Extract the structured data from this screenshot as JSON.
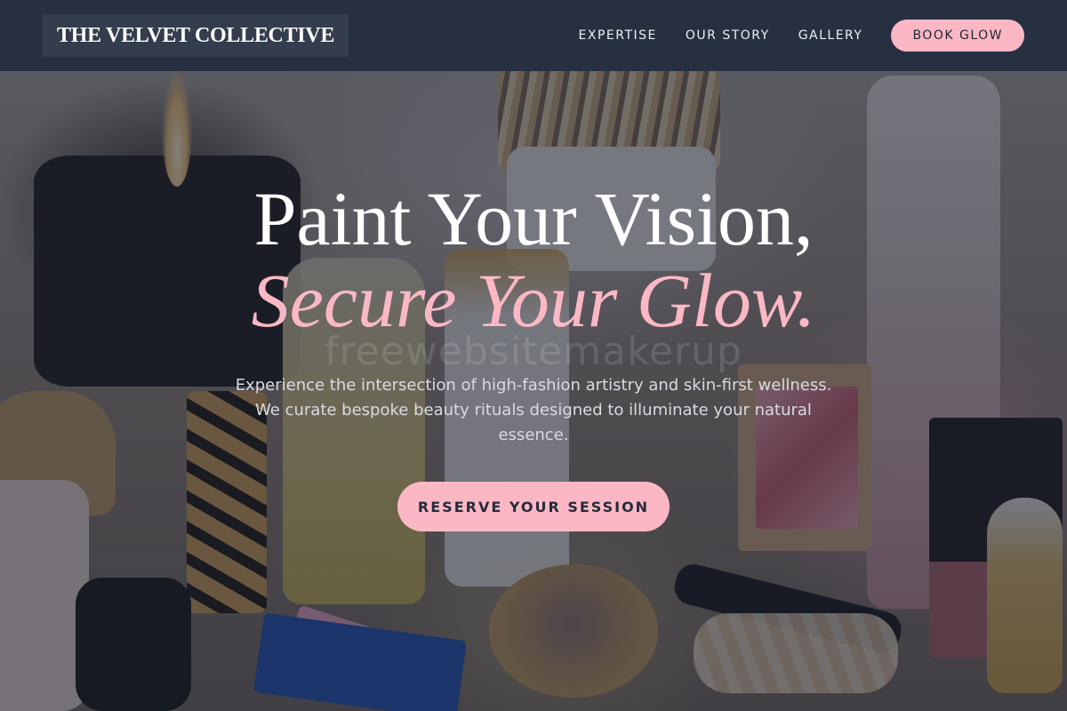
{
  "header": {
    "logo_text": "THE VELVET COLLECTIVE",
    "nav": [
      {
        "label": "EXPERTISE"
      },
      {
        "label": "OUR STORY"
      },
      {
        "label": "GALLERY"
      }
    ],
    "cta_label": "BOOK GLOW"
  },
  "hero": {
    "headline_line1": "Paint Your Vision,",
    "headline_line2": "Secure Your Glow.",
    "watermark": "freewebsitemakerup",
    "description": "Experience the intersection of high-fashion artistry and skin-first wellness. We curate bespoke beauty rituals designed to illuminate your natural essence.",
    "cta_label": "RESERVE YOUR SESSION"
  },
  "colors": {
    "nav_background": "#273041",
    "accent_pink": "#fbb8c4",
    "headline_white": "#ffffff",
    "cta_text": "#252b3b"
  }
}
